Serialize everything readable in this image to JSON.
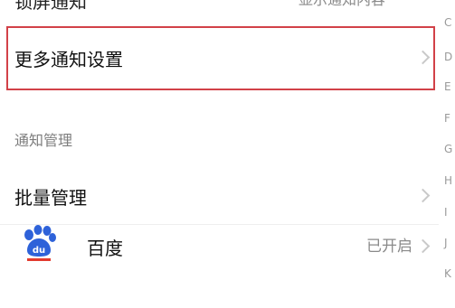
{
  "top_partial": {
    "title": "锁屏通知",
    "value": "显示通知内容"
  },
  "more_settings": {
    "label": "更多通知设置"
  },
  "section_header": "通知管理",
  "batch_manage": {
    "label": "批量管理"
  },
  "apps": [
    {
      "name": "百度",
      "status": "已开启",
      "logo_text": "du",
      "icon": "baidu-paw-icon"
    }
  ],
  "index_letters": [
    "C",
    "D",
    "E",
    "F",
    "G",
    "H",
    "I",
    "J",
    "K"
  ],
  "colors": {
    "highlight_border": "#d24148",
    "baidu_blue": "#2e62d9",
    "baidu_red": "#e23a2e",
    "secondary_text": "#8a8a8a",
    "divider": "#eeeeee"
  }
}
